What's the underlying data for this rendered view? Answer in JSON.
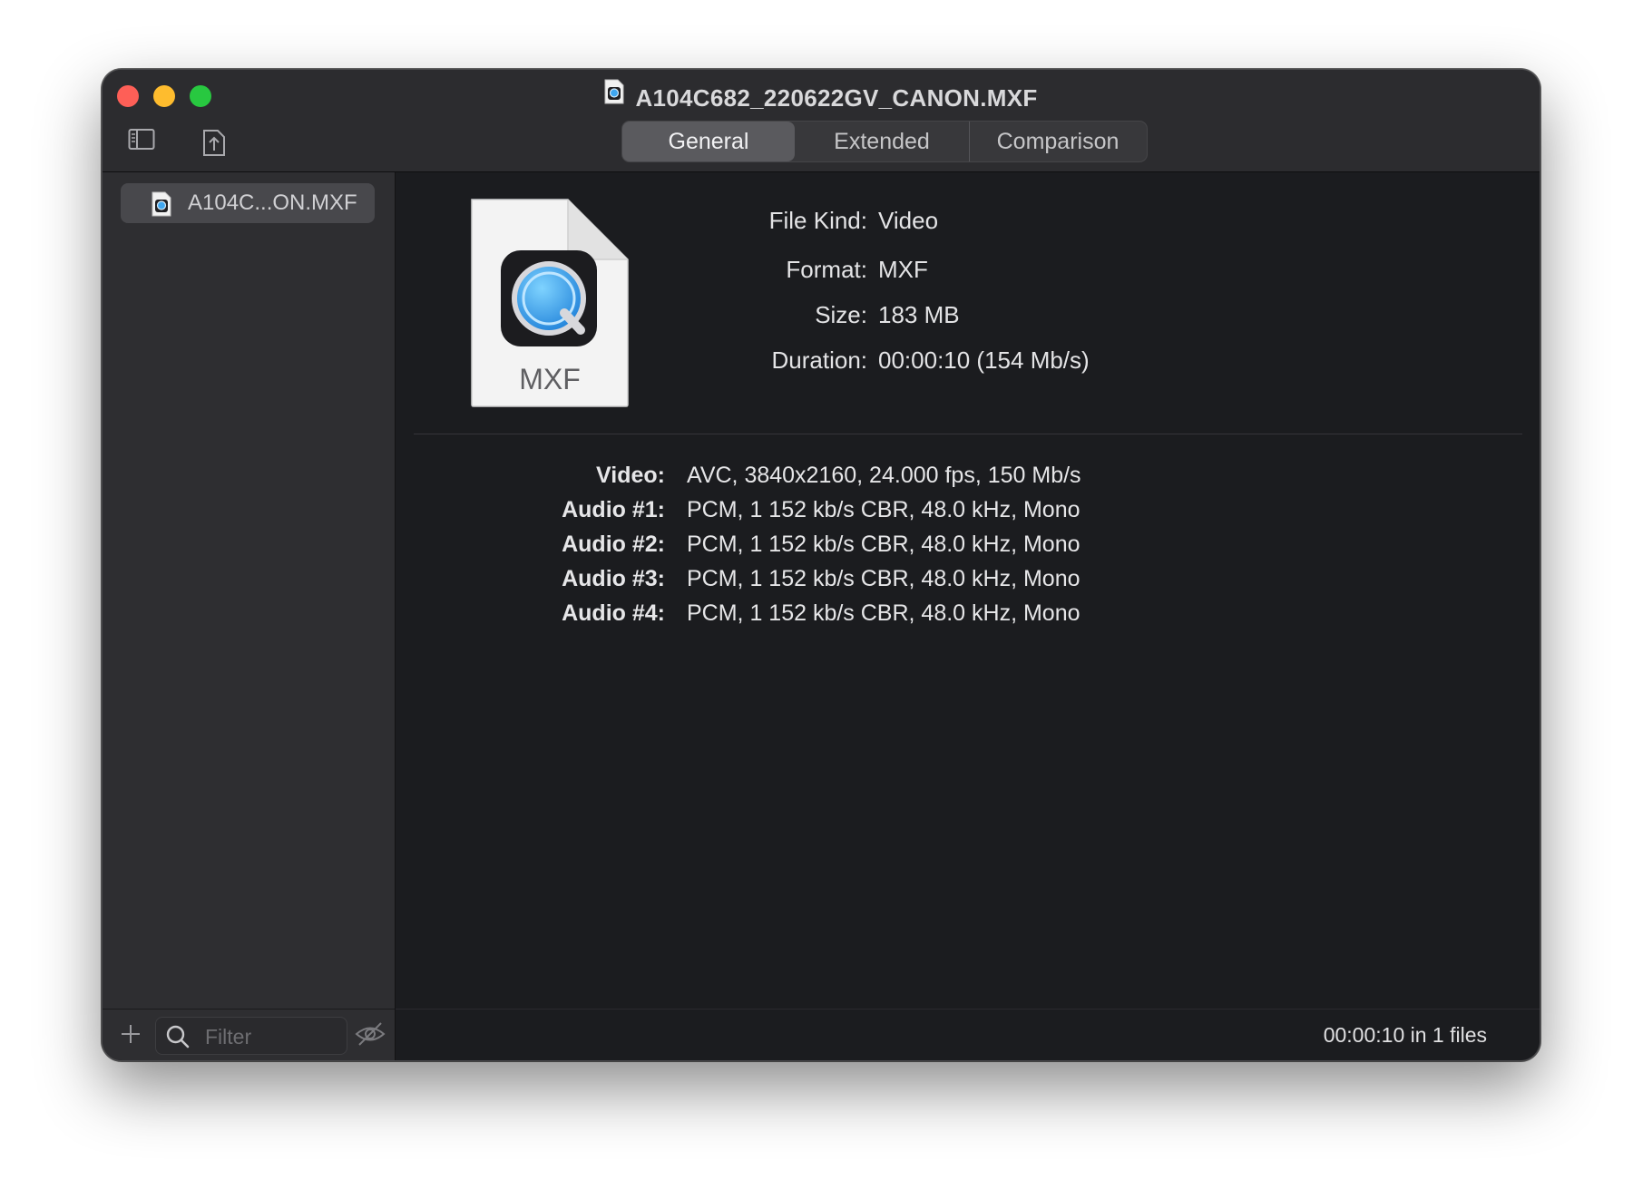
{
  "window": {
    "title": "A104C682_220622GV_CANON.MXF",
    "controls": [
      "close",
      "minimize",
      "maximize"
    ]
  },
  "toolbar": {
    "icons": [
      "sidebar-toggle-icon",
      "share-icon"
    ],
    "tabs": [
      {
        "label": "General",
        "selected": true
      },
      {
        "label": "Extended",
        "selected": false
      },
      {
        "label": "Comparison",
        "selected": false
      }
    ]
  },
  "sidebar": {
    "items": [
      {
        "label": "A104C...ON.MXF",
        "icon": "quicktime-doc-icon",
        "selected": true
      }
    ],
    "filter": {
      "placeholder": "Filter",
      "value": ""
    }
  },
  "file_icon": {
    "label": "MXF"
  },
  "general": {
    "file_kind": {
      "label": "File Kind:",
      "value": "Video"
    },
    "format": {
      "label": "Format:",
      "value": "MXF"
    },
    "size": {
      "label": "Size:",
      "value": "183 MB"
    },
    "duration": {
      "label": "Duration:",
      "value": "00:00:10 (154 Mb/s)"
    }
  },
  "streams": [
    {
      "label": "Video:",
      "value": "AVC, 3840x2160, 24.000 fps, 150 Mb/s"
    },
    {
      "label": "Audio #1:",
      "value": "PCM, 1 152 kb/s CBR, 48.0 kHz, Mono"
    },
    {
      "label": "Audio #2:",
      "value": "PCM, 1 152 kb/s CBR, 48.0 kHz, Mono"
    },
    {
      "label": "Audio #3:",
      "value": "PCM, 1 152 kb/s CBR, 48.0 kHz, Mono"
    },
    {
      "label": "Audio #4:",
      "value": "PCM, 1 152 kb/s CBR, 48.0 kHz, Mono"
    }
  ],
  "status": {
    "text": "00:00:10 in 1 files"
  },
  "colors": {
    "close": "#fe5f57",
    "minimize": "#febc2e",
    "maximize": "#28c840",
    "window_bg": "#1b1c1f",
    "sidebar_bg": "#2e2e31"
  }
}
